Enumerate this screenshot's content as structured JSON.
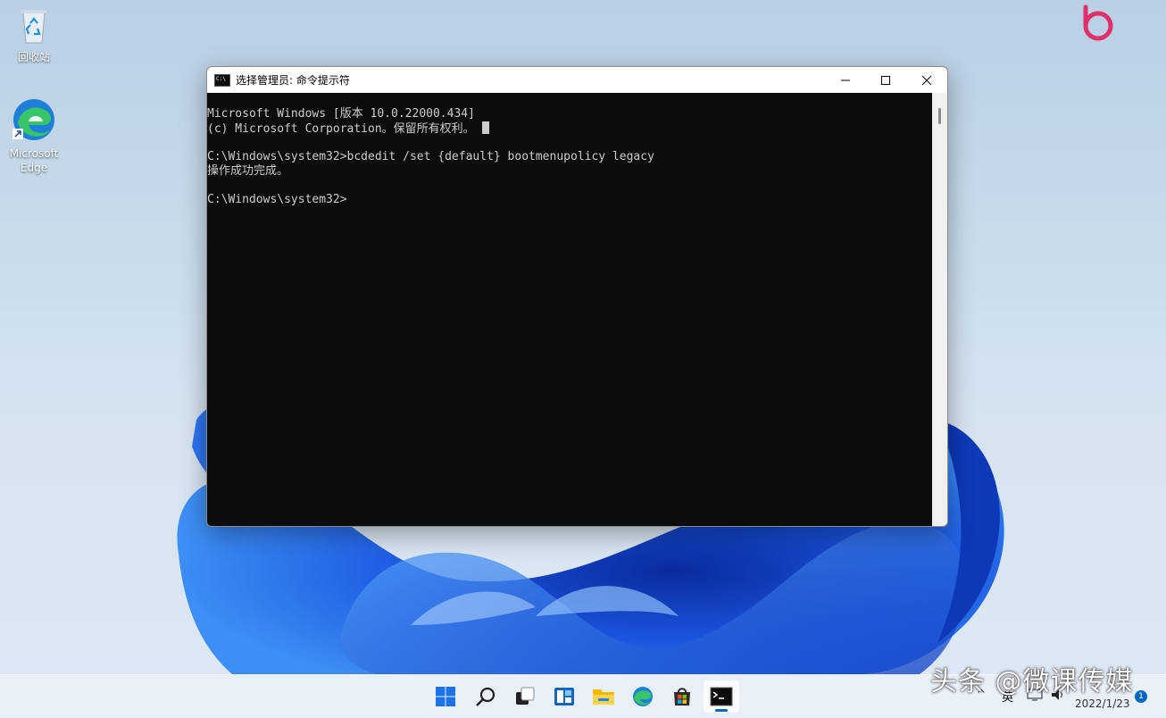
{
  "desktop": {
    "icons": [
      {
        "label": "回收站",
        "icon": "recycle-bin-icon"
      },
      {
        "label": "Microsoft Edge",
        "icon": "edge-icon"
      }
    ]
  },
  "window": {
    "title": "选择管理员: 命令提示符",
    "icon": "command-prompt-icon",
    "controls": [
      "minimize-icon",
      "maximize-icon",
      "close-icon"
    ],
    "console_lines": [
      "Microsoft Windows [版本 10.0.22000.434]",
      "(c) Microsoft Corporation。保留所有权利。",
      "",
      "C:\\Windows\\system32>bcdedit /set {default} bootmenupolicy legacy",
      "操作成功完成。",
      "",
      "C:\\Windows\\system32>"
    ]
  },
  "taskbar": {
    "items": [
      {
        "name": "start",
        "icon": "windows-start-icon"
      },
      {
        "name": "search",
        "icon": "search-icon"
      },
      {
        "name": "task-view",
        "icon": "task-view-icon"
      },
      {
        "name": "widgets",
        "icon": "widgets-icon"
      },
      {
        "name": "file-explorer",
        "icon": "folder-icon"
      },
      {
        "name": "edge",
        "icon": "edge-icon"
      },
      {
        "name": "store",
        "icon": "store-icon"
      },
      {
        "name": "terminal",
        "icon": "command-prompt-icon",
        "active": true
      }
    ],
    "tray": {
      "language": "英",
      "date": "2022/1/23",
      "notification_count": "1"
    }
  },
  "watermark": "头条 @微课传媒",
  "colors": {
    "accent": "#0067c0",
    "console_bg": "#0c0c0c",
    "console_text": "#cccccc",
    "brand": "#e0306a"
  }
}
